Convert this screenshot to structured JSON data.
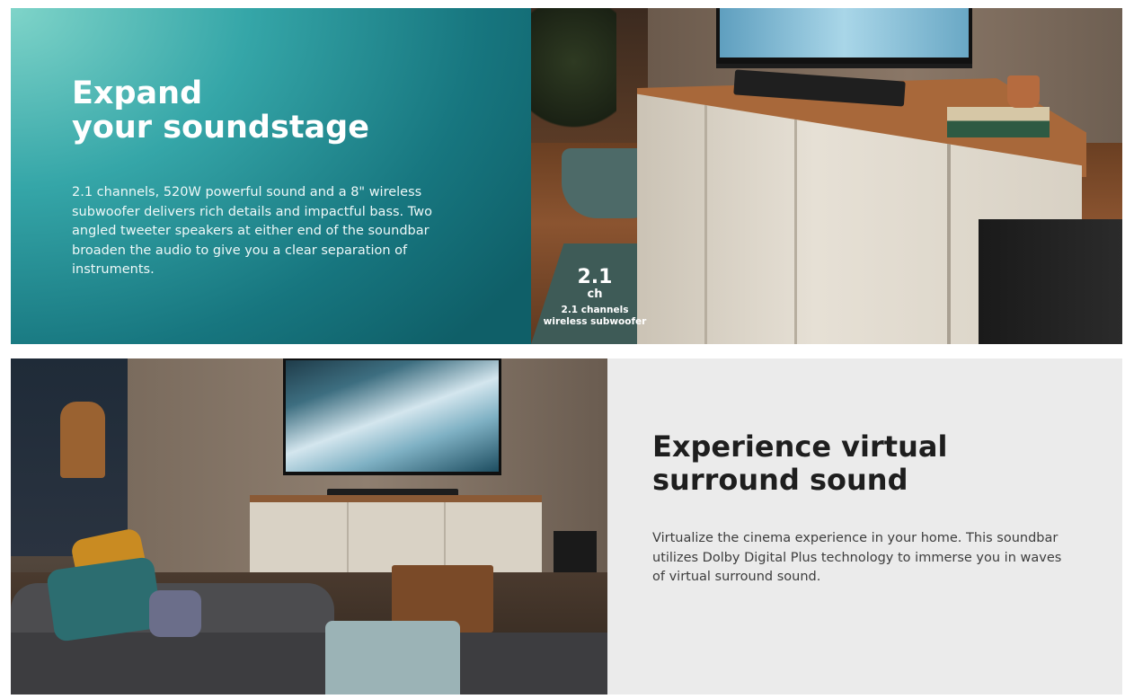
{
  "banner1": {
    "title_line1": "Expand",
    "title_line2": "your soundstage",
    "body": "2.1 channels, 520W powerful sound and a 8\" wireless subwoofer delivers rich details and impactful bass. Two angled tweeter speakers at either end of the soundbar broaden the audio to give you a clear separation of instruments.",
    "badge": {
      "number": "2.1",
      "unit": "ch",
      "line1": "2.1 channels",
      "line2": "wireless subwoofer"
    }
  },
  "banner2": {
    "title_line1": "Experience virtual",
    "title_line2": "surround sound",
    "body": "Virtualize the cinema experience in your home. This soundbar utilizes Dolby Digital Plus technology to immerse you in waves of virtual surround sound."
  }
}
